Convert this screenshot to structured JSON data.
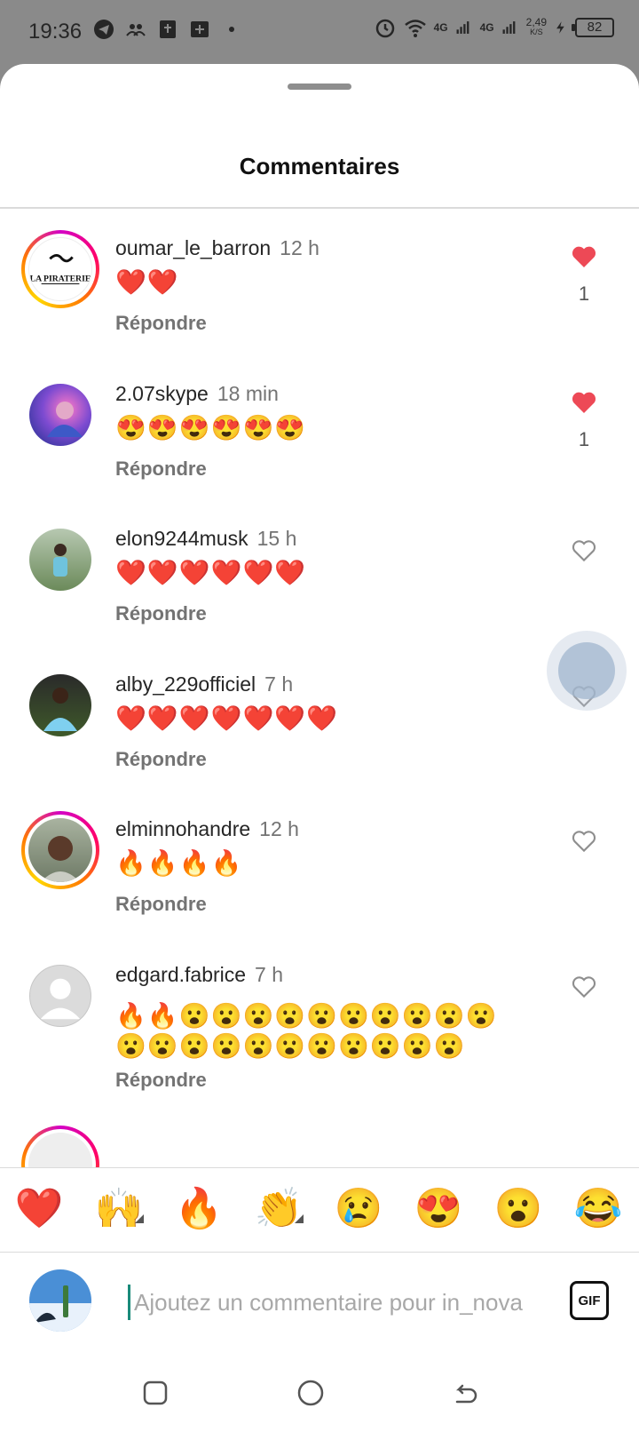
{
  "status_bar": {
    "time": "19:36",
    "network_1": "4G",
    "network_2": "4G",
    "speed_value": "2,49",
    "speed_unit": "K/S",
    "battery": "82"
  },
  "sheet": {
    "title": "Commentaires"
  },
  "comments": [
    {
      "username": "oumar_le_barron",
      "time": "12 h",
      "text": "❤️❤️",
      "reply_label": "Répondre",
      "liked": true,
      "like_count": "1",
      "avatar_ring": true,
      "avatar_text": "LA PIRATERIE"
    },
    {
      "username": "2.07skype",
      "time": "18 min",
      "text": "😍😍😍😍😍😍",
      "reply_label": "Répondre",
      "liked": true,
      "like_count": "1",
      "avatar_ring": false
    },
    {
      "username": "elon9244musk",
      "time": "15 h",
      "text": "❤️❤️❤️❤️❤️❤️",
      "reply_label": "Répondre",
      "liked": false,
      "avatar_ring": false
    },
    {
      "username": "alby_229officiel",
      "time": "7 h",
      "text": "❤️❤️❤️❤️❤️❤️❤️",
      "reply_label": "Répondre",
      "liked": false,
      "avatar_ring": false
    },
    {
      "username": "elminnohandre",
      "time": "12 h",
      "text": "🔥🔥🔥🔥",
      "reply_label": "Répondre",
      "liked": false,
      "avatar_ring": true
    },
    {
      "username": "edgard.fabrice",
      "time": "7 h",
      "text": "🔥🔥😮😮😮😮😮😮😮😮😮😮😮😮😮😮😮😮😮😮😮😮😮",
      "reply_label": "Répondre",
      "liked": false,
      "avatar_ring": false
    }
  ],
  "emoji_bar": [
    "❤️",
    "🙌",
    "🔥",
    "👏",
    "😢",
    "😍",
    "😮",
    "😂"
  ],
  "input": {
    "placeholder": "Ajoutez un commentaire pour in_nova",
    "gif_label": "GIF"
  },
  "colors": {
    "like_red": "#ed4956",
    "muted_text": "#737373"
  }
}
